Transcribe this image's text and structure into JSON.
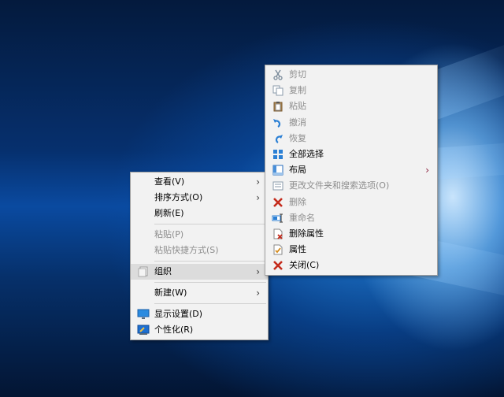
{
  "desktop_menu": {
    "items": [
      {
        "label": "查看(V)",
        "submenu": true,
        "disabled": false
      },
      {
        "label": "排序方式(O)",
        "submenu": true,
        "disabled": false
      },
      {
        "label": "刷新(E)",
        "submenu": false,
        "disabled": false
      },
      {
        "label": "粘贴(P)",
        "submenu": false,
        "disabled": true
      },
      {
        "label": "粘贴快捷方式(S)",
        "submenu": false,
        "disabled": true
      },
      {
        "label": "组织",
        "submenu": true,
        "disabled": false,
        "highlighted": true
      },
      {
        "label": "新建(W)",
        "submenu": true,
        "disabled": false
      },
      {
        "label": "显示设置(D)",
        "submenu": false,
        "disabled": false,
        "icon": "display-settings-icon"
      },
      {
        "label": "个性化(R)",
        "submenu": false,
        "disabled": false,
        "icon": "personalize-icon"
      }
    ],
    "arrow_glyph": "›"
  },
  "organize_menu": {
    "items": [
      {
        "label": "剪切",
        "disabled": true,
        "icon": "scissors-icon"
      },
      {
        "label": "复制",
        "disabled": true,
        "icon": "copy-icon"
      },
      {
        "label": "粘贴",
        "disabled": true,
        "icon": "paste-icon"
      },
      {
        "label": "撤消",
        "disabled": true,
        "icon": "undo-icon"
      },
      {
        "label": "恢复",
        "disabled": true,
        "icon": "redo-icon"
      },
      {
        "label": "全部选择",
        "disabled": false,
        "icon": "select-all-icon"
      },
      {
        "label": "布局",
        "disabled": false,
        "icon": "layout-icon",
        "submenu": true
      },
      {
        "label": "更改文件夹和搜索选项(O)",
        "disabled": true,
        "icon": "folder-options-icon"
      },
      {
        "label": "删除",
        "disabled": true,
        "icon": "delete-icon"
      },
      {
        "label": "重命名",
        "disabled": true,
        "icon": "rename-icon"
      },
      {
        "label": "删除属性",
        "disabled": false,
        "icon": "remove-properties-icon"
      },
      {
        "label": "属性",
        "disabled": false,
        "icon": "properties-icon"
      },
      {
        "label": "关闭(C)",
        "disabled": false,
        "icon": "close-icon"
      }
    ],
    "arrow_glyph": "›",
    "accent_color": "#c42b1c",
    "arrow_color": "#8a1c3a"
  }
}
